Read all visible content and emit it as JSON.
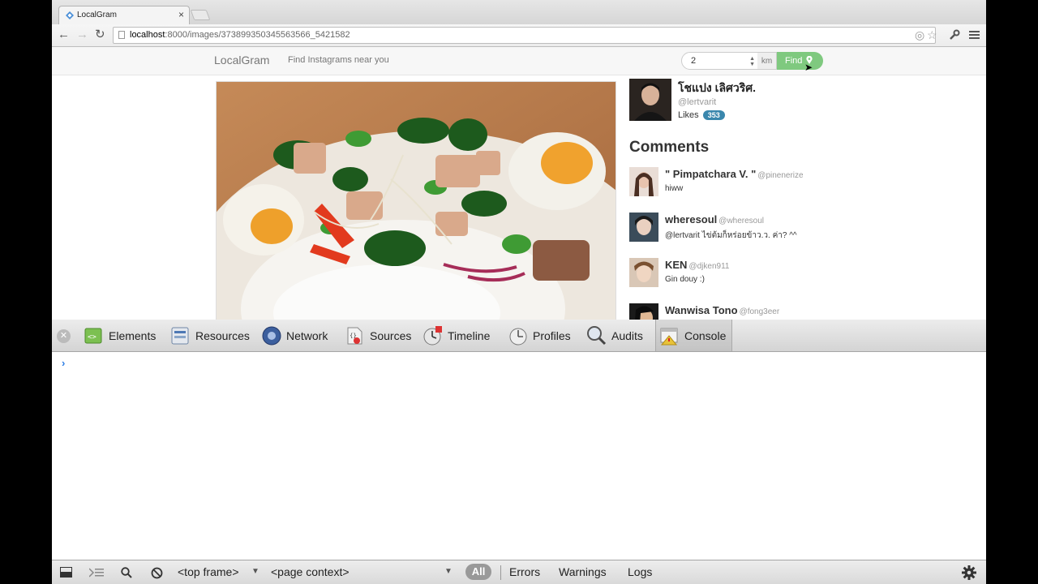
{
  "browser": {
    "tab_title": "LocalGram",
    "tab_close": "×",
    "url_host": "localhost",
    "url_path": ":8000/images/373899350345563566_5421582"
  },
  "navbar": {
    "brand": "LocalGram",
    "tagline": "Find Instagrams near you",
    "radius_value": "2",
    "radius_unit": "km",
    "find_label": "Find"
  },
  "post": {
    "user_name": "โชแปง เลิศวริศ.",
    "user_handle": "@lertvarit",
    "likes_label": "Likes",
    "likes_count": "353"
  },
  "comments": {
    "heading": "Comments",
    "items": [
      {
        "name": "\" Pimpatchara V. \"",
        "handle": "@pinenerize",
        "text": "hiww"
      },
      {
        "name": "wheresoul",
        "handle": "@wheresoul",
        "text": "@lertvarit ไข่ต้มก็หร่อยข้าว.ว. ค่า? ^^"
      },
      {
        "name": "KEN",
        "handle": "@djken911",
        "text": "Gin douy :)"
      },
      {
        "name": "Wanwisa Tono",
        "handle": "@fong3eer",
        "text": ""
      }
    ]
  },
  "devtools": {
    "tabs": [
      "Elements",
      "Resources",
      "Network",
      "Sources",
      "Timeline",
      "Profiles",
      "Audits",
      "Console"
    ],
    "selected_tab": "Console",
    "prompt": "›",
    "frame_select": "<top frame>",
    "context_select": "<page context>",
    "filter_all": "All",
    "filters": [
      "Errors",
      "Warnings",
      "Logs"
    ]
  }
}
